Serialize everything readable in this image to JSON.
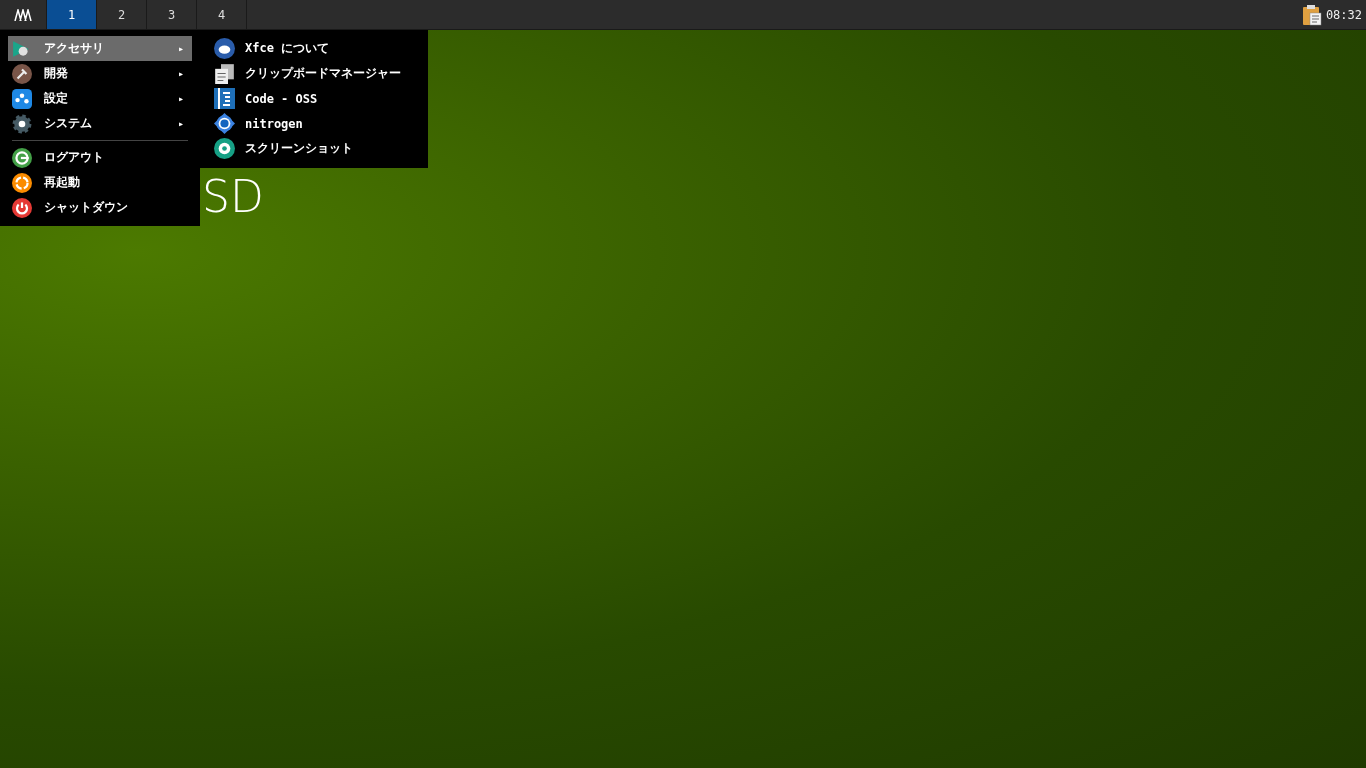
{
  "panel": {
    "workspaces": [
      {
        "label": "1",
        "selected": true
      },
      {
        "label": "2",
        "selected": false
      },
      {
        "label": "3",
        "selected": false
      },
      {
        "label": "4",
        "selected": false
      }
    ],
    "clock": "08:32"
  },
  "desktop": {
    "wallpaper_text": "SD"
  },
  "menu": {
    "items": [
      {
        "kind": "submenu",
        "label": "アクセサリ",
        "selected": true,
        "arrow": "▸"
      },
      {
        "kind": "submenu",
        "label": "開発",
        "selected": false,
        "arrow": "▸"
      },
      {
        "kind": "submenu",
        "label": "設定",
        "selected": false,
        "arrow": "▸"
      },
      {
        "kind": "submenu",
        "label": "システム",
        "selected": false,
        "arrow": "▸"
      },
      {
        "kind": "separator"
      },
      {
        "kind": "action",
        "label": "ログアウト",
        "selected": false
      },
      {
        "kind": "action",
        "label": "再起動",
        "selected": false
      },
      {
        "kind": "action",
        "label": "シャットダウン",
        "selected": false
      }
    ]
  },
  "submenu": {
    "items": [
      {
        "label": "Xfce について"
      },
      {
        "label": "クリップボードマネージャー"
      },
      {
        "label": "Code - OSS"
      },
      {
        "label": "nitrogen"
      },
      {
        "label": "スクリーンショット"
      }
    ]
  }
}
